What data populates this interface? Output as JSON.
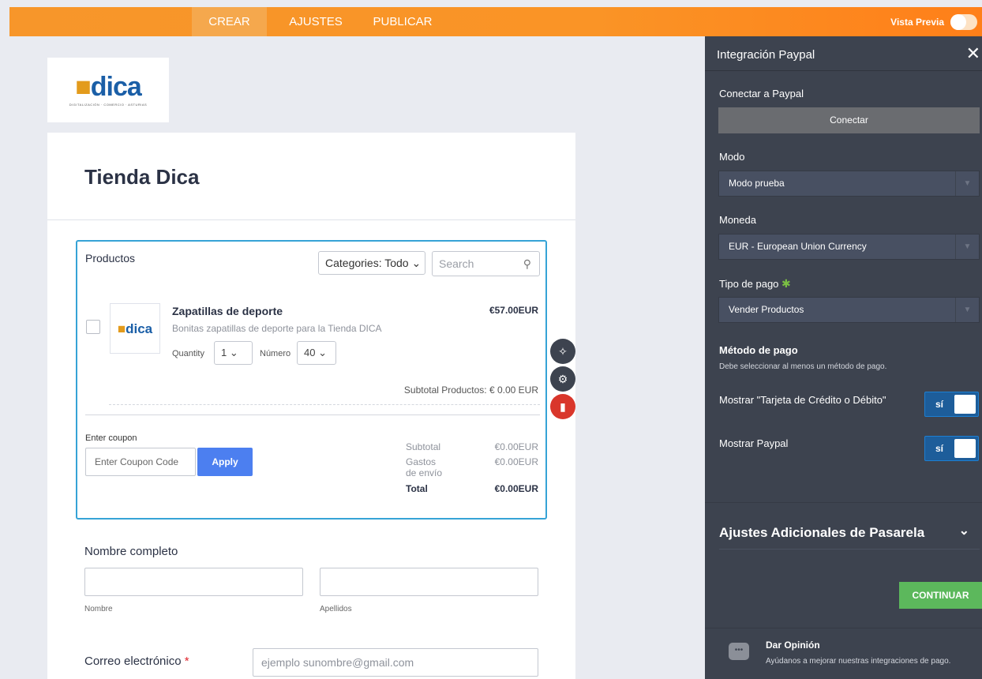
{
  "topbar": {
    "tabs": [
      {
        "label": "CREAR",
        "active": true
      },
      {
        "label": "AJUSTES",
        "active": false
      },
      {
        "label": "PUBLICAR",
        "active": false
      }
    ],
    "preview_label": "Vista Previa"
  },
  "logo": {
    "text_main": "dica",
    "text_sub": "DIGITALIZACIÓN · COMERCIO · ASTURIAS"
  },
  "form": {
    "title": "Tienda Dica",
    "products": {
      "label": "Productos",
      "category_select": "Categories: Todo",
      "search_placeholder": "Search",
      "item": {
        "name": "Zapatillas de deporte",
        "description": "Bonitas zapatillas de deporte para la Tienda DICA",
        "price": "€57.00EUR",
        "quantity_label": "Quantity",
        "quantity_value": "1",
        "numero_label": "Número",
        "numero_value": "40"
      },
      "subtotal_products": "Subtotal Productos:  € 0.00 EUR",
      "coupon_label": "Enter coupon",
      "coupon_placeholder": "Enter Coupon Code",
      "apply_label": "Apply",
      "summary": {
        "subtotal_label": "Subtotal",
        "subtotal_value": "€0.00EUR",
        "gastos_label_1": "Gastos",
        "gastos_label_2": "de envío",
        "gastos_value": "€0.00EUR",
        "total_label": "Total",
        "total_value": "€0.00EUR"
      }
    },
    "full_name": {
      "title": "Nombre completo",
      "first_label": "Nombre",
      "last_label": "Apellidos"
    },
    "email": {
      "title": "Correo electrónico",
      "required_mark": "*",
      "placeholder": "ejemplo sunombre@gmail.com"
    }
  },
  "panel": {
    "title": "Integración Paypal",
    "connect_label": "Conectar a Paypal",
    "connect_button": "Conectar",
    "mode_label": "Modo",
    "mode_value": "Modo prueba",
    "currency_label": "Moneda",
    "currency_value": "EUR - European Union Currency",
    "payment_type_label": "Tipo de pago",
    "payment_type_value": "Vender Productos",
    "payment_method_title": "Método de pago",
    "payment_method_note": "Debe seleccionar al menos un método de pago.",
    "show_card_label": "Mostrar \"Tarjeta de Crédito o Débito\"",
    "show_card_toggle": "sí",
    "show_paypal_label": "Mostrar Paypal",
    "show_paypal_toggle": "sí",
    "additional_settings": "Ajustes Adicionales de Pasarela",
    "continue_button": "CONTINUAR",
    "feedback_title": "Dar Opinión",
    "feedback_sub": "Ayúdanos a mejorar nuestras integraciones de pago."
  },
  "colors": {
    "accent_orange": "#fa9426",
    "panel_bg": "#3d434f",
    "apply_blue": "#4c7ff0",
    "continue_green": "#5cb85c",
    "delete_red": "#d9362b"
  }
}
